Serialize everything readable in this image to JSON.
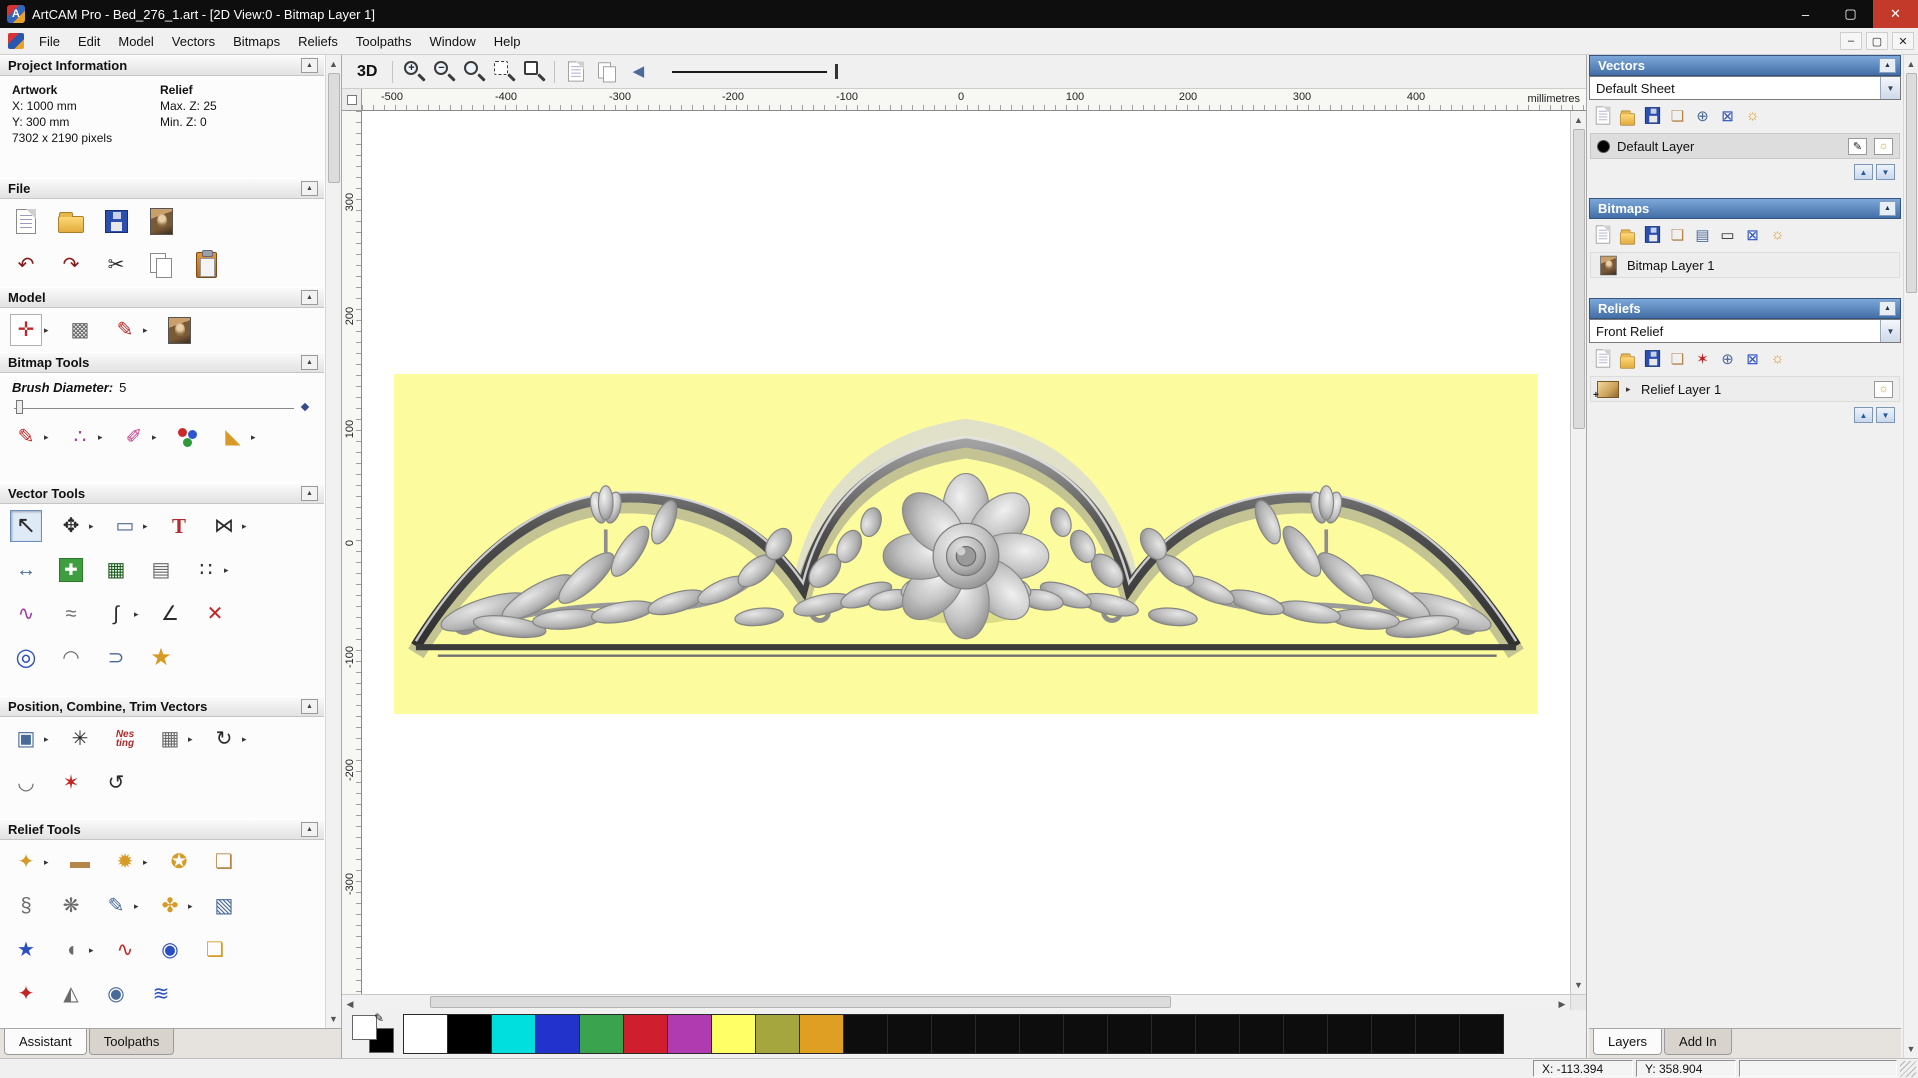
{
  "window": {
    "app_badge": "A",
    "title": "ArtCAM Pro - Bed_276_1.art - [2D View:0 - Bitmap Layer 1]"
  },
  "menu": {
    "items": [
      "File",
      "Edit",
      "Model",
      "Vectors",
      "Bitmaps",
      "Reliefs",
      "Toolpaths",
      "Window",
      "Help"
    ]
  },
  "left_panel": {
    "project_information": {
      "title": "Project Information",
      "artwork_label": "Artwork",
      "relief_label": "Relief",
      "x": "X: 1000 mm",
      "y": "Y: 300 mm",
      "pixels": "7302 x 2190 pixels",
      "max_z": "Max. Z: 25",
      "min_z": "Min. Z: 0"
    },
    "file": {
      "title": "File"
    },
    "model": {
      "title": "Model"
    },
    "bitmap_tools": {
      "title": "Bitmap Tools",
      "brush_label": "Brush Diameter:",
      "brush_value": "5"
    },
    "vector_tools": {
      "title": "Vector Tools"
    },
    "position_tools": {
      "title": "Position, Combine, Trim Vectors"
    },
    "relief_tools": {
      "title": "Relief Tools"
    },
    "tabs": {
      "assistant": "Assistant",
      "toolpaths": "Toolpaths"
    }
  },
  "canvas": {
    "view3d": "3D",
    "ruler_units": "millimetres",
    "ruler_h": [
      "-500",
      "-400",
      "-300",
      "-200",
      "-100",
      "0",
      "100",
      "200",
      "300",
      "400"
    ],
    "ruler_v": [
      "300",
      "200",
      "100",
      "0",
      "-100",
      "-200",
      "-300"
    ]
  },
  "right_panel": {
    "vectors": {
      "title": "Vectors",
      "sheet": "Default Sheet",
      "layer": "Default Layer"
    },
    "bitmaps": {
      "title": "Bitmaps",
      "layer": "Bitmap Layer 1"
    },
    "reliefs": {
      "title": "Reliefs",
      "relief": "Front Relief",
      "layer": "Relief Layer 1"
    },
    "tabs": {
      "layers": "Layers",
      "addin": "Add In"
    }
  },
  "palette": {
    "colors": [
      "#ffffff",
      "#000000",
      "#00dede",
      "#2233cc",
      "#3aa34e",
      "#cf1f2f",
      "#b03ab0",
      "#ffff66",
      "#a6a63e",
      "#de9f22",
      "#0d0d0d",
      "#0d0d0d",
      "#0d0d0d",
      "#0d0d0d",
      "#0d0d0d",
      "#0d0d0d",
      "#0d0d0d",
      "#0d0d0d",
      "#0d0d0d",
      "#0d0d0d",
      "#0d0d0d",
      "#0d0d0d",
      "#0d0d0d",
      "#0d0d0d",
      "#0d0d0d"
    ]
  },
  "status": {
    "x": "X: -113.394",
    "y": "Y: 358.904"
  },
  "icons": {
    "collapse": "▲",
    "expand_down": "▼",
    "flyout": "▸",
    "minimize": "–",
    "maximize": "▢",
    "close": "✕",
    "scroll_up": "▲",
    "scroll_down": "▼",
    "scroll_left": "◀",
    "scroll_right": "▶",
    "undo": "↶",
    "redo": "↷",
    "cut": "✂",
    "brush": "✎",
    "airbrush": "∴",
    "eyedropper": "✐",
    "flood_fill": "◣",
    "select": "↖",
    "transform": "✥",
    "rect_tool": "▭",
    "text_tool": "T",
    "mirror": "⋈",
    "measure": "↔",
    "polyline_create": "✚",
    "bitmap_to_vector": "▦",
    "fence": "▤",
    "dot_array": "∷",
    "curve_create": "∿",
    "smooth_curve": "≈",
    "spline": "∫",
    "angle_line": "∠",
    "node_cut": "✕",
    "donut": "◎",
    "arc_tool": "◠",
    "offset_tool": "⊃",
    "star_tool": "★",
    "align": "▣",
    "circular_array": "✳",
    "block_array": "▦",
    "rotate_copy": "↻",
    "nesting_1": "Nes",
    "nesting_2": "ting",
    "arc_fit": "◡",
    "weld": "✶",
    "spiral": "↺",
    "model_size": "✛",
    "model_origin": "▩",
    "model_note": "✎",
    "relief_1": "✦",
    "relief_2": "▬",
    "relief_3": "✹",
    "relief_4": "✪",
    "relief_5": "❏",
    "relief_6": "§",
    "relief_7": "❋",
    "relief_8": "✎",
    "relief_9": "✤",
    "relief_10": "▧",
    "relief_11": "★",
    "relief_12": "◖",
    "relief_13": "∿",
    "relief_14": "◉",
    "relief_15": "❏",
    "relief_16": "✦",
    "relief_17": "◭",
    "relief_18": "◉",
    "relief_19": "≋",
    "zoom_plus": "+",
    "zoom_minus": "−",
    "sheet": "❏",
    "levels": "▤",
    "slider_icon": "▭",
    "merge": "⊕",
    "trash": "⊠",
    "bulb": "☼",
    "edit": "✎",
    "plus": "+"
  }
}
